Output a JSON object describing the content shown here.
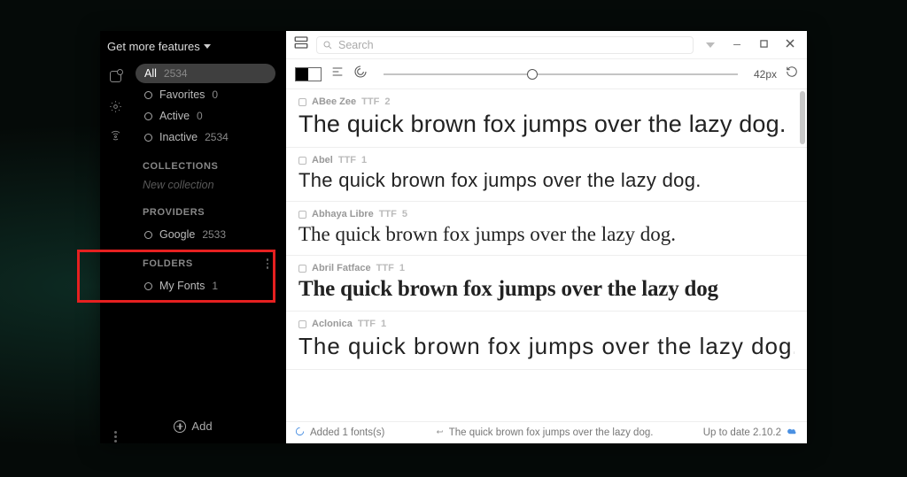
{
  "header": {
    "get_more": "Get more features"
  },
  "filters": {
    "all": {
      "label": "All",
      "count": "2534"
    },
    "favorites": {
      "label": "Favorites",
      "count": "0"
    },
    "active": {
      "label": "Active",
      "count": "0"
    },
    "inactive": {
      "label": "Inactive",
      "count": "2534"
    }
  },
  "sections": {
    "collections": "COLLECTIONS",
    "new_collection_placeholder": "New collection",
    "providers": "PROVIDERS",
    "folders": "FOLDERS"
  },
  "providers": {
    "google": {
      "label": "Google",
      "count": "2533"
    }
  },
  "folders": {
    "myfonts": {
      "label": "My Fonts",
      "count": "1"
    }
  },
  "add_button": "Add",
  "toolbar": {
    "search_placeholder": "Search",
    "size_label": "42px",
    "slider_pct": "42"
  },
  "fonts": [
    {
      "name": "ABee Zee",
      "format": "TTF",
      "weights": "2",
      "specimen": "The quick brown fox jumps over the lazy dog."
    },
    {
      "name": "Abel",
      "format": "TTF",
      "weights": "1",
      "specimen": "The quick brown fox jumps over the lazy dog."
    },
    {
      "name": "Abhaya Libre",
      "format": "TTF",
      "weights": "5",
      "specimen": "The quick brown fox jumps over the lazy dog."
    },
    {
      "name": "Abril Fatface",
      "format": "TTF",
      "weights": "1",
      "specimen": "The quick brown fox jumps over the lazy dog"
    },
    {
      "name": "Aclonica",
      "format": "TTF",
      "weights": "1",
      "specimen": "The quick brown fox jumps over the lazy dog."
    }
  ],
  "status": {
    "left": "Added 1 fonts(s)",
    "mid": "The quick brown fox jumps over the lazy dog.",
    "right": "Up to date 2.10.2"
  }
}
